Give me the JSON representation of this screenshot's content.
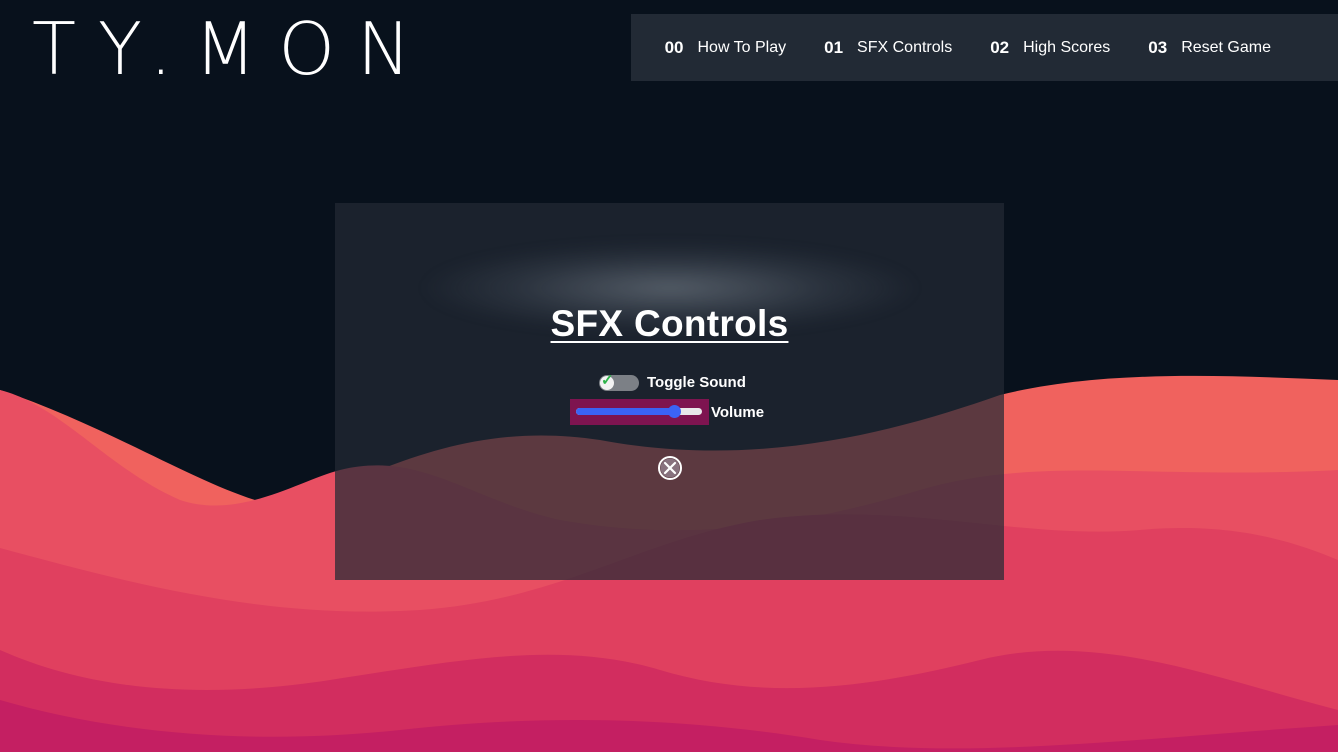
{
  "logo": {
    "text": "TY.MON"
  },
  "nav": {
    "items": [
      {
        "num": "00",
        "label": "How To Play"
      },
      {
        "num": "01",
        "label": "SFX Controls"
      },
      {
        "num": "02",
        "label": "High Scores"
      },
      {
        "num": "03",
        "label": "Reset Game"
      }
    ]
  },
  "modal": {
    "title": "SFX Controls",
    "toggle_label": "Toggle Sound",
    "toggle_checked": true,
    "volume_label": "Volume",
    "volume_value": 0.78,
    "close_icon": "circle-x-icon"
  },
  "colors": {
    "background": "#08111c",
    "nav_bg": "#222a35",
    "slider_accent": "#3b63f5",
    "slider_focus": "#7e1450",
    "wave_coral": "#f0625e",
    "wave_red": "#e64e62",
    "wave_pink": "#d6305f",
    "wave_magenta": "#c41f62"
  }
}
